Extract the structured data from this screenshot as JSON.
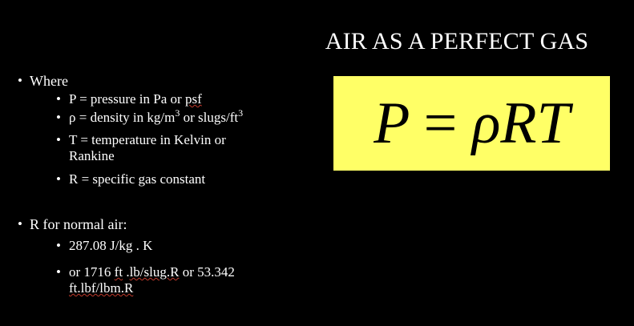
{
  "slide": {
    "title": "AIR AS A PERFECT GAS",
    "formula": {
      "left": "P",
      "equals": "=",
      "rho": "ρ",
      "r": "R",
      "t": "T"
    },
    "bullet_glyph": "•",
    "where_label": "Where",
    "definitions": {
      "p": "P = pressure in Pa or ",
      "p_unit": "psf",
      "rho_pre": "ρ = density in kg/m",
      "rho_exp": "3",
      "rho_mid": " or  slugs/ft",
      "rho_exp2": "3",
      "t_line1": "T = temperature in Kelvin or",
      "t_line2": "Rankine",
      "r": "R = specific gas  constant"
    },
    "r_label": "R for normal air:",
    "r_values": {
      "si": "287.08 J/kg .  K",
      "imp_pre": "or 1716 ",
      "imp_ft": "ft",
      "imp_sp": " .",
      "imp_slug": "lb/slug.R",
      "imp_mid": " or 53.342",
      "imp_line2": "ft.lbf/lbm.R"
    }
  },
  "colors": {
    "background": "#000000",
    "text": "#ffffff",
    "formula_box": "#ffff66",
    "formula_text": "#000000"
  }
}
